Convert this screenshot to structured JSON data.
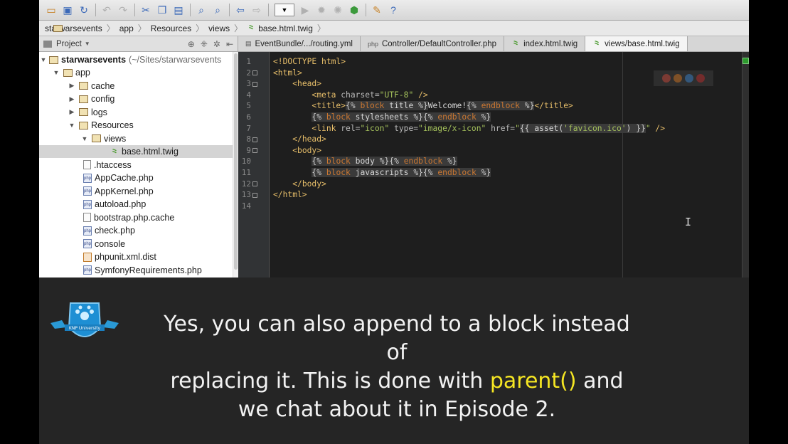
{
  "breadcrumb": [
    "starwarsevents",
    "app",
    "Resources",
    "views",
    "base.html.twig"
  ],
  "project_panel": {
    "title": "Project"
  },
  "tabs": [
    {
      "label": "EventBundle/.../routing.yml",
      "icon": "yml-icon",
      "active": false
    },
    {
      "label": "Controller/DefaultController.php",
      "icon": "php-icon",
      "active": false
    },
    {
      "label": "index.html.twig",
      "icon": "twig-icon",
      "active": false
    },
    {
      "label": "views/base.html.twig",
      "icon": "twig-icon",
      "active": true
    }
  ],
  "tree": {
    "root": "starwarsevents",
    "root_path": "(~/Sites/starwarsevents",
    "items": [
      {
        "label": "app"
      },
      {
        "label": "cache"
      },
      {
        "label": "config"
      },
      {
        "label": "logs"
      },
      {
        "label": "Resources"
      },
      {
        "label": "views"
      },
      {
        "label": "base.html.twig",
        "selected": true
      },
      {
        "label": ".htaccess"
      },
      {
        "label": "AppCache.php"
      },
      {
        "label": "AppKernel.php"
      },
      {
        "label": "autoload.php"
      },
      {
        "label": "bootstrap.php.cache"
      },
      {
        "label": "check.php"
      },
      {
        "label": "console"
      },
      {
        "label": "phpunit.xml.dist"
      },
      {
        "label": "SymfonyRequirements.php"
      }
    ]
  },
  "editor": {
    "line_numbers": [
      "1",
      "2",
      "3",
      "4",
      "5",
      "6",
      "7",
      "8",
      "9",
      "10",
      "11",
      "12",
      "13",
      "14"
    ]
  },
  "caption": {
    "line1": "Yes, you can also append to a block instead of",
    "line2_pre": "replacing it. This is done with ",
    "line2_highlight": "parent()",
    "line2_post": " and",
    "line3": "we chat about it in Episode 2.",
    "highlight_color": "#f5e623"
  },
  "logo": {
    "text": "KNP University"
  }
}
